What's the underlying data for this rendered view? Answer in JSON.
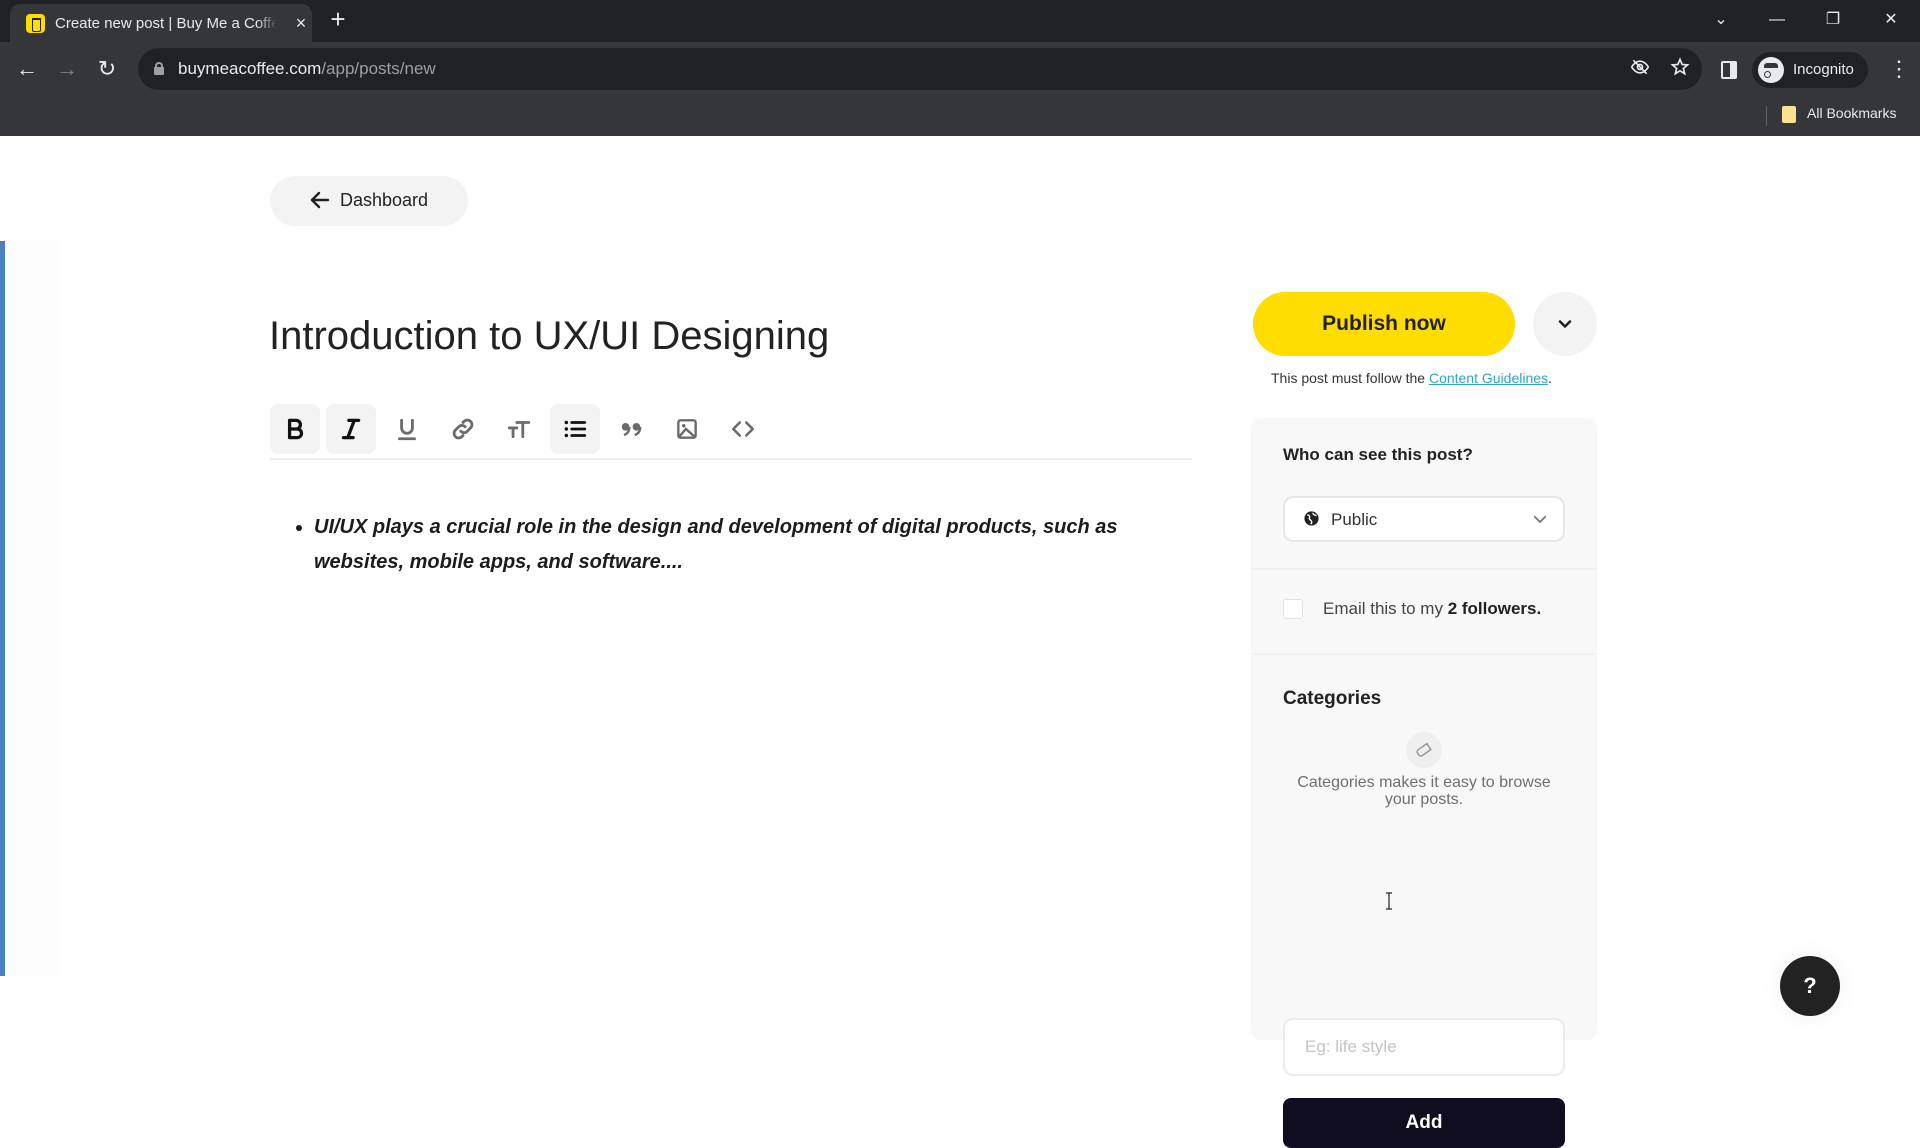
{
  "browser": {
    "tab_title": "Create new post | Buy Me a Coffee",
    "tab_close": "×",
    "new_tab": "+",
    "url_host": "buymeacoffee.com",
    "url_path": "/app/posts/new",
    "profile_label": "Incognito",
    "bookmarks_label": "All Bookmarks",
    "window_controls": {
      "tab_search": "⌄",
      "minimize": "—",
      "restore": "❐",
      "close": "✕"
    },
    "nav": {
      "back": "←",
      "forward": "→",
      "reload": "↻"
    }
  },
  "header": {
    "back_label": "Dashboard"
  },
  "editor": {
    "title": "Introduction to UX/UI Designing",
    "toolbar": [
      {
        "name": "bold",
        "active": true
      },
      {
        "name": "italic",
        "active": true
      },
      {
        "name": "underline",
        "active": false
      },
      {
        "name": "link",
        "active": false
      },
      {
        "name": "text-size",
        "active": false
      },
      {
        "name": "bullet-list",
        "active": true
      },
      {
        "name": "quote",
        "active": false
      },
      {
        "name": "image",
        "active": false
      },
      {
        "name": "code",
        "active": false
      }
    ],
    "body_items": [
      "UI/UX plays a crucial role in the design and development of digital products, such as websites, mobile apps, and software...."
    ]
  },
  "sidebar": {
    "publish_label": "Publish now",
    "guidelines_prefix": "This post must follow the ",
    "guidelines_link": "Content Guidelines",
    "guidelines_suffix": ".",
    "visibility_label": "Who can see this post?",
    "visibility_value": "Public",
    "email_prefix": "Email this to my ",
    "email_count": "2 followers.",
    "email_checked": false,
    "categories_title": "Categories",
    "categories_desc": "Categories makes it easy to browse your posts.",
    "category_placeholder": "Eg: life style",
    "category_value": "",
    "add_label": "Add"
  },
  "help": {
    "label": "?"
  },
  "colors": {
    "brand_yellow": "#ffdd00",
    "add_button": "#110d20",
    "link": "#2fa5c6",
    "accent_bar": "#4a7fc1"
  }
}
